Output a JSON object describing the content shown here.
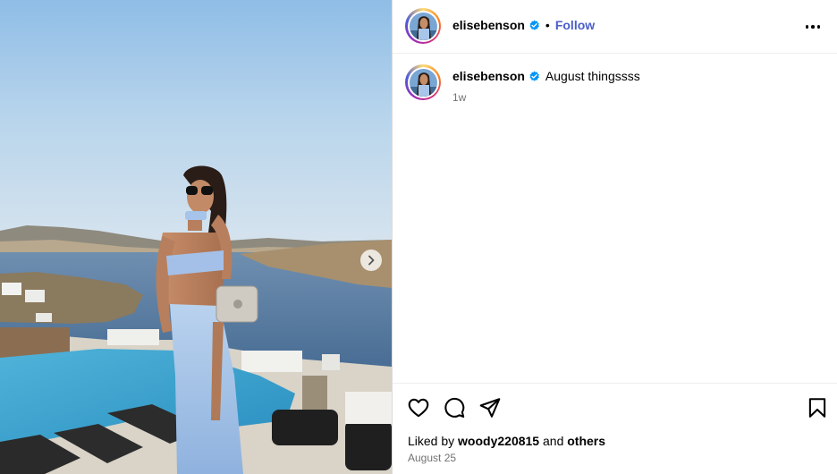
{
  "post": {
    "photo_alt": "Woman in light blue outfit on a terrace overlooking the sea",
    "next_icon": "chevron-right-icon"
  },
  "header": {
    "username": "elisebenson",
    "separator": "•",
    "follow_label": "Follow",
    "verified_icon": "verified-badge-icon",
    "more_icon": "more-options-icon"
  },
  "caption": {
    "username": "elisebenson",
    "text": "August thingssss",
    "age": "1w"
  },
  "actions": {
    "icons": [
      "heart-icon",
      "comment-icon",
      "share-icon",
      "save-icon"
    ]
  },
  "likes": {
    "prefix": "Liked by",
    "user": "woody220815",
    "joiner": "and",
    "others": "others"
  },
  "date": "August 25",
  "colors": {
    "accent": "#4a5ec8",
    "verified": "#0095f6",
    "muted": "#737373",
    "border": "#dbdbdb"
  }
}
